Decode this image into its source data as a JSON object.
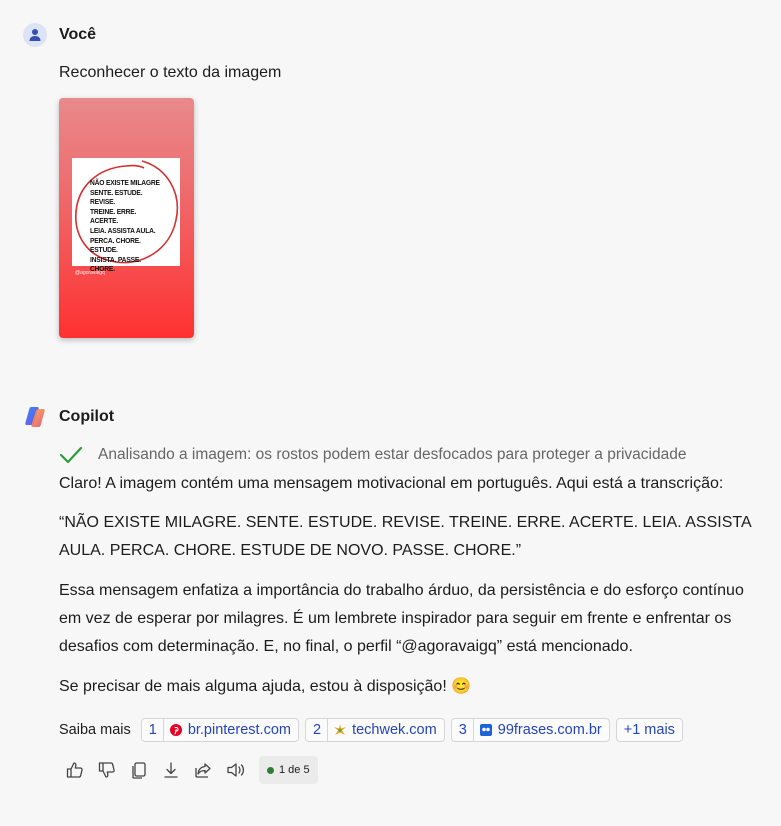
{
  "user": {
    "name": "Você",
    "message": "Reconhecer o texto da imagem",
    "image": {
      "lines": [
        "NÃO EXISTE MILAGRE",
        "SENTE. ESTUDE. REVISE.",
        "TREINE. ERRE. ACERTE.",
        "LEIA. ASSISTA AULA.",
        "PERCA. CHORE. ESTUDE.",
        "INSISTA. PASSE. CHORE."
      ],
      "handle": "@agoravaigq"
    }
  },
  "copilot": {
    "name": "Copilot",
    "status": "Analisando a imagem: os rostos podem estar desfocados para proteger a privacidade",
    "paragraphs": [
      "Claro! A imagem contém uma mensagem motivacional em português. Aqui está a transcrição:",
      "“NÃO EXISTE MILAGRE. SENTE. ESTUDE. REVISE. TREINE. ERRE. ACERTE. LEIA. ASSISTA AULA. PERCA. CHORE. ESTUDE DE NOVO. PASSE. CHORE.”",
      "Essa mensagem enfatiza a importância do trabalho árduo, da persistência e do esforço contínuo em vez de esperar por milagres. É um lembrete inspirador para seguir em frente e enfrentar os desafios com determinação. E, no final, o perfil “@agoravaigq” está mencionado.",
      "Se precisar de mais alguma ajuda, estou à disposição! 😊"
    ],
    "sources_label": "Saiba mais",
    "sources": [
      {
        "num": "1",
        "label": "br.pinterest.com",
        "icon": "pinterest-icon"
      },
      {
        "num": "2",
        "label": "techwek.com",
        "icon": "techwek-icon"
      },
      {
        "num": "3",
        "label": "99frases.com.br",
        "icon": "99frases-icon"
      }
    ],
    "more_sources": "+1 mais",
    "pager": "1 de 5"
  },
  "colors": {
    "accent": "#2445b7",
    "success": "#2e7d32",
    "thumb_top": "#e88a8c",
    "thumb_bottom": "#ff3030"
  }
}
